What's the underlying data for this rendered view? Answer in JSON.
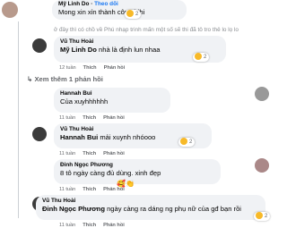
{
  "comments": [
    {
      "name": "Mỹ Linh Do",
      "follow": "Theo dõi",
      "text": "Mong xin xỉn thành công hihi",
      "reaction": {
        "count": "2"
      }
    },
    {
      "muted_text": "ở đây thì có chồ về Phú nhạp trinh mấn một số sẽ thi đã tô tro thẻ lo lọ lo"
    },
    {
      "name": "Vũ Thu Hoài",
      "tag": "Mỹ Linh Do",
      "text": "nhà là định lun nhaa",
      "actions": {
        "time": "12 tuần",
        "like": "Thích",
        "reply": "Phản hồi"
      },
      "reaction": {
        "count": "2"
      }
    },
    {
      "more": "Xem thêm 1 phản hồi"
    },
    {
      "name": "Hannah Bui",
      "text": "Của xuyhhhhhh",
      "actions": {
        "time": "11 tuần",
        "like": "Thích",
        "reply": "Phản hồi"
      }
    },
    {
      "name": "Vũ Thu Hoài",
      "tag": "Hannah Bui",
      "text": "mải xuynh nhóooo",
      "actions": {
        "time": "11 tuần",
        "like": "Thích",
        "reply": "Phản hồi"
      },
      "reaction": {
        "count": "2"
      }
    },
    {
      "name": "Đinh Ngọc Phương",
      "text": "8 tô ngày càng đủ dùng. xinh đẹp",
      "actions": {
        "time": "11 tuần",
        "like": "Thích",
        "reply": "Phản hồi"
      },
      "emojis": "🥰👏"
    },
    {
      "name": "Vũ Thu Hoài",
      "tag": "Đinh Ngọc Phương",
      "text": "ngày càng ra dáng ng phụ nữ của gđ bạn rồi",
      "actions": {
        "time": "11 tuần",
        "like": "Thích",
        "reply": "Phản hồi"
      },
      "reaction": {
        "count": "2"
      }
    }
  ]
}
